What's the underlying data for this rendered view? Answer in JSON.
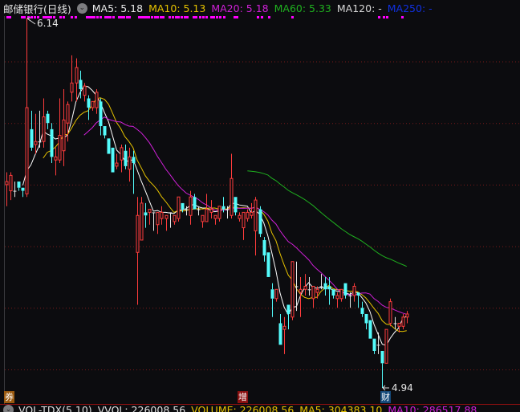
{
  "header": {
    "title": "邮储银行(日线)",
    "ma5": "MA5: 5.18",
    "ma10": "MA10: 5.13",
    "ma20": "MA20: 5.18",
    "ma60": "MA60: 5.33",
    "ma120": "MA120: -",
    "ma250": "MA250: -"
  },
  "footer": {
    "indicator": "VOL-TDX(5,10)",
    "vvol": "VVOL: 226008.56",
    "volume": "VOLUME: 226008.56",
    "ma5": "MA5: 304383.10",
    "ma10": "MA10: 286517.88"
  },
  "markers": {
    "left": "券",
    "mid": "增",
    "right": "财"
  },
  "colors": {
    "up": "#ff3c3c",
    "down": "#54fcfc",
    "ma5": "#ffffff",
    "ma10": "#e6c200",
    "ma20": "#d020d8",
    "ma60": "#1fb01f",
    "ma250": "#1030e0",
    "grid": "#7a1a1a"
  },
  "chart_data": {
    "type": "candlestick",
    "title": "邮储银行(日线)",
    "high_label": "6.14",
    "low_label": "4.94",
    "ylim": [
      4.94,
      6.14
    ],
    "grid_levels": [
      5.0,
      5.2,
      5.4,
      5.6,
      5.8,
      6.0
    ],
    "ohlc_fields": [
      "open",
      "high",
      "low",
      "close"
    ],
    "candles": [
      [
        5.6,
        5.64,
        5.53,
        5.61
      ],
      [
        5.58,
        5.64,
        5.55,
        5.63
      ],
      [
        5.58,
        5.61,
        5.56,
        5.58
      ],
      [
        5.61,
        5.61,
        5.58,
        5.59
      ],
      [
        5.59,
        5.59,
        5.56,
        5.58
      ],
      [
        5.57,
        6.14,
        5.56,
        5.85
      ],
      [
        5.78,
        5.84,
        5.71,
        5.72
      ],
      [
        5.73,
        5.83,
        5.7,
        5.74
      ],
      [
        5.74,
        5.84,
        5.72,
        5.74
      ],
      [
        5.74,
        5.88,
        5.72,
        5.82
      ],
      [
        5.83,
        5.84,
        5.78,
        5.8
      ],
      [
        5.78,
        5.8,
        5.67,
        5.69
      ],
      [
        5.68,
        5.72,
        5.63,
        5.69
      ],
      [
        5.68,
        5.88,
        5.67,
        5.76
      ],
      [
        5.71,
        5.91,
        5.66,
        5.81
      ],
      [
        5.8,
        5.87,
        5.74,
        5.86
      ],
      [
        5.9,
        6.02,
        5.87,
        5.93
      ],
      [
        5.93,
        6.01,
        5.87,
        5.98
      ],
      [
        5.94,
        5.97,
        5.88,
        5.91
      ],
      [
        5.89,
        5.93,
        5.87,
        5.92
      ],
      [
        5.88,
        5.89,
        5.81,
        5.85
      ],
      [
        5.85,
        5.87,
        5.84,
        5.87
      ],
      [
        5.85,
        5.91,
        5.83,
        5.9
      ],
      [
        5.87,
        5.88,
        5.76,
        5.79
      ],
      [
        5.79,
        5.79,
        5.75,
        5.76
      ],
      [
        5.75,
        5.75,
        5.7,
        5.7
      ],
      [
        5.72,
        5.72,
        5.64,
        5.64
      ],
      [
        5.66,
        5.7,
        5.65,
        5.67
      ],
      [
        5.68,
        5.73,
        5.64,
        5.72
      ],
      [
        5.71,
        5.73,
        5.65,
        5.66
      ],
      [
        5.65,
        5.72,
        5.61,
        5.69
      ],
      [
        5.69,
        5.71,
        5.57,
        5.67
      ],
      [
        5.38,
        5.56,
        5.21,
        5.5
      ],
      [
        5.42,
        5.56,
        5.42,
        5.54
      ],
      [
        5.51,
        5.54,
        5.46,
        5.5
      ],
      [
        5.51,
        5.52,
        5.47,
        5.52
      ],
      [
        5.51,
        5.51,
        5.45,
        5.51
      ],
      [
        5.47,
        5.51,
        5.44,
        5.51
      ],
      [
        5.49,
        5.53,
        5.47,
        5.51
      ],
      [
        5.49,
        5.5,
        5.45,
        5.5
      ],
      [
        5.51,
        5.51,
        5.46,
        5.51
      ],
      [
        5.48,
        5.5,
        5.47,
        5.5
      ],
      [
        5.49,
        5.56,
        5.48,
        5.56
      ],
      [
        5.54,
        5.54,
        5.51,
        5.52
      ],
      [
        5.52,
        5.53,
        5.5,
        5.52
      ],
      [
        5.5,
        5.58,
        5.47,
        5.56
      ],
      [
        5.56,
        5.57,
        5.52,
        5.52
      ],
      [
        5.52,
        5.53,
        5.5,
        5.52
      ],
      [
        5.48,
        5.5,
        5.46,
        5.5
      ],
      [
        5.48,
        5.57,
        5.48,
        5.52
      ],
      [
        5.51,
        5.55,
        5.49,
        5.52
      ],
      [
        5.49,
        5.5,
        5.47,
        5.5
      ],
      [
        5.49,
        5.53,
        5.48,
        5.53
      ],
      [
        5.53,
        5.56,
        5.51,
        5.52
      ],
      [
        5.52,
        5.53,
        5.49,
        5.52
      ],
      [
        5.5,
        5.7,
        5.49,
        5.62
      ],
      [
        5.56,
        5.56,
        5.5,
        5.51
      ],
      [
        5.49,
        5.51,
        5.48,
        5.5
      ],
      [
        5.46,
        5.51,
        5.42,
        5.51
      ],
      [
        5.49,
        5.52,
        5.48,
        5.51
      ],
      [
        5.5,
        5.54,
        5.49,
        5.51
      ],
      [
        5.45,
        5.56,
        5.37,
        5.55
      ],
      [
        5.52,
        5.53,
        5.43,
        5.44
      ],
      [
        5.42,
        5.43,
        5.35,
        5.37
      ],
      [
        5.38,
        5.38,
        5.3,
        5.3
      ],
      [
        5.26,
        5.28,
        5.17,
        5.23
      ],
      [
        5.23,
        5.26,
        5.22,
        5.26
      ],
      [
        5.15,
        5.18,
        5.08,
        5.08
      ],
      [
        5.13,
        5.17,
        5.05,
        5.14
      ],
      [
        5.21,
        5.21,
        5.13,
        5.18
      ],
      [
        5.17,
        5.35,
        5.16,
        5.35
      ],
      [
        5.27,
        5.35,
        5.19,
        5.27
      ],
      [
        5.25,
        5.3,
        5.17,
        5.26
      ],
      [
        5.26,
        5.31,
        5.24,
        5.27
      ],
      [
        5.26,
        5.3,
        5.24,
        5.26
      ],
      [
        5.23,
        5.27,
        5.2,
        5.27
      ],
      [
        5.25,
        5.27,
        5.23,
        5.26
      ],
      [
        5.27,
        5.31,
        5.26,
        5.27
      ],
      [
        5.28,
        5.3,
        5.24,
        5.26
      ],
      [
        5.27,
        5.3,
        5.21,
        5.26
      ],
      [
        5.26,
        5.26,
        5.23,
        5.24
      ],
      [
        5.23,
        5.25,
        5.2,
        5.24
      ],
      [
        5.23,
        5.26,
        5.22,
        5.26
      ],
      [
        5.28,
        5.28,
        5.23,
        5.24
      ],
      [
        5.24,
        5.25,
        5.2,
        5.24
      ],
      [
        5.24,
        5.28,
        5.22,
        5.27
      ],
      [
        5.25,
        5.25,
        5.2,
        5.24
      ],
      [
        5.2,
        5.22,
        5.17,
        5.18
      ],
      [
        5.18,
        5.18,
        5.13,
        5.15
      ],
      [
        5.16,
        5.16,
        5.1,
        5.1
      ],
      [
        5.1,
        5.1,
        5.05,
        5.06
      ],
      [
        5.08,
        5.12,
        5.05,
        5.08
      ],
      [
        5.06,
        5.06,
        4.94,
        5.02
      ],
      [
        5.02,
        5.13,
        5.02,
        5.13
      ],
      [
        5.15,
        5.23,
        5.14,
        5.22
      ],
      [
        5.15,
        5.17,
        5.13,
        5.15
      ],
      [
        5.14,
        5.15,
        5.12,
        5.15
      ],
      [
        5.14,
        5.18,
        5.13,
        5.17
      ],
      [
        5.17,
        5.19,
        5.15,
        5.18
      ]
    ],
    "moving_averages": [
      {
        "name": "MA5",
        "period": 5,
        "last": 5.18
      },
      {
        "name": "MA10",
        "period": 10,
        "last": 5.13
      },
      {
        "name": "MA20",
        "period": 20,
        "last": 5.18
      },
      {
        "name": "MA60",
        "period": 60,
        "last": 5.33
      }
    ]
  }
}
